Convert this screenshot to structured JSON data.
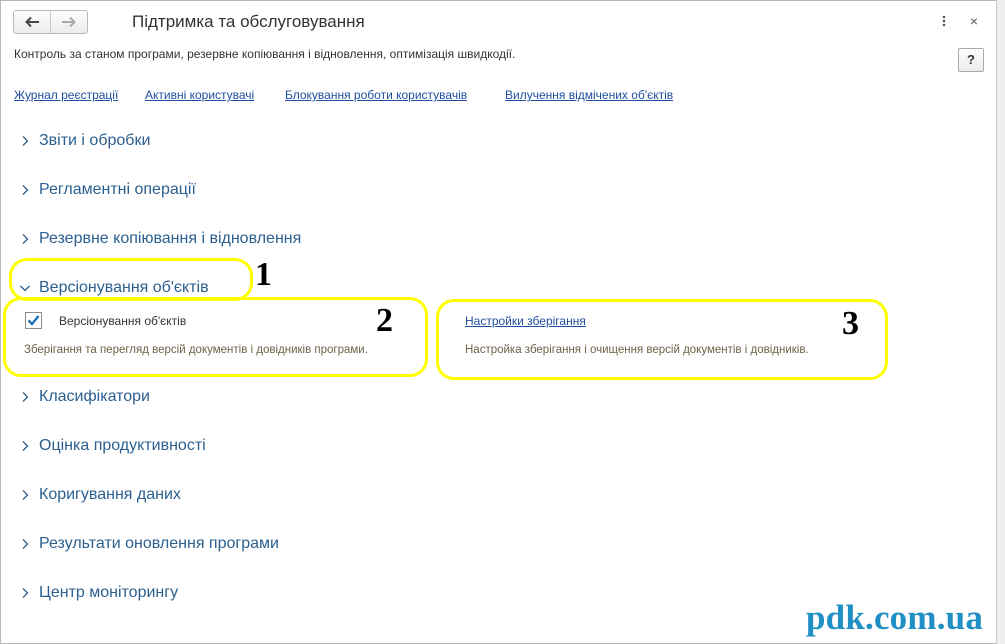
{
  "window": {
    "title": "Підтримка та обслуговування",
    "subtitle": "Контроль за станом програми, резервне копіювання і відновлення, оптимізація швидкодії.",
    "help_label": "?",
    "close_label": "×"
  },
  "links": [
    "Журнал реєстрації",
    "Активні користувачі",
    "Блокування роботи користувачів",
    "Вилучення відмічених об'єктів"
  ],
  "sections": [
    {
      "label": "Звіти і обробки",
      "expanded": false
    },
    {
      "label": "Регламентні операції",
      "expanded": false
    },
    {
      "label": "Резервне копіювання і відновлення",
      "expanded": false
    },
    {
      "label": "Версіонування об'єктів",
      "expanded": true
    },
    {
      "label": "Класифікатори",
      "expanded": false
    },
    {
      "label": "Оцінка продуктивності",
      "expanded": false
    },
    {
      "label": "Коригування даних",
      "expanded": false
    },
    {
      "label": "Результати оновлення програми",
      "expanded": false
    },
    {
      "label": "Центр моніторингу",
      "expanded": false
    }
  ],
  "versioning": {
    "checkbox_label": "Версіонування об'єктів",
    "checkbox_checked": true,
    "checkbox_description": "Зберігання та перегляд версій документів і довідників програми.",
    "settings_link": "Настройки зберігання",
    "settings_description": "Настройка зберігання і очищення версій документів і довідників."
  },
  "annotations": [
    "1",
    "2",
    "3"
  ],
  "watermark": "pdk.com.ua",
  "colors": {
    "highlight": "#ffff00",
    "link": "#1f4fa1",
    "section_label": "#2b5f8f",
    "description": "#6e6248",
    "checkbox_tick": "#1a6fb5",
    "watermark": "#1f8fc4"
  }
}
